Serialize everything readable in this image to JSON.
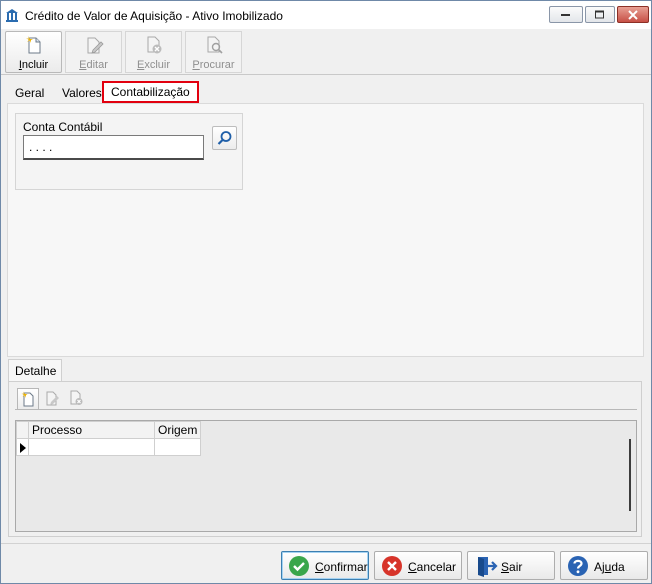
{
  "window": {
    "title": "Crédito de Valor de Aquisição - Ativo Imobilizado"
  },
  "toolbar": {
    "incluir": {
      "u": "I",
      "rest": "ncluir"
    },
    "editar": {
      "u": "E",
      "rest": "ditar"
    },
    "excluir": {
      "u": "E",
      "rest": "xcluir"
    },
    "procurar": {
      "u": "P",
      "rest": "rocurar"
    }
  },
  "tabs": {
    "geral": "Geral",
    "valores": "Valores",
    "contabilizacao": "Contabilização"
  },
  "conta_contabil": {
    "label": "Conta Contábil",
    "value": ". . . ."
  },
  "detalhe": {
    "tab_label": "Detalhe",
    "columns": [
      "Processo",
      "Origem"
    ]
  },
  "footer": {
    "confirmar": {
      "u": "C",
      "rest": "onfirmar"
    },
    "cancelar": {
      "u": "C",
      "rest": "ancelar"
    },
    "sair": {
      "u": "S",
      "rest": "air"
    },
    "ajuda": {
      "pre": "Aj",
      "u": "u",
      "rest": "da"
    }
  },
  "colors": {
    "selected_tab_border": "#e2000f",
    "confirm_icon": "#3aa64b",
    "cancel_icon": "#d7342a",
    "help_icon": "#2a63b3"
  }
}
